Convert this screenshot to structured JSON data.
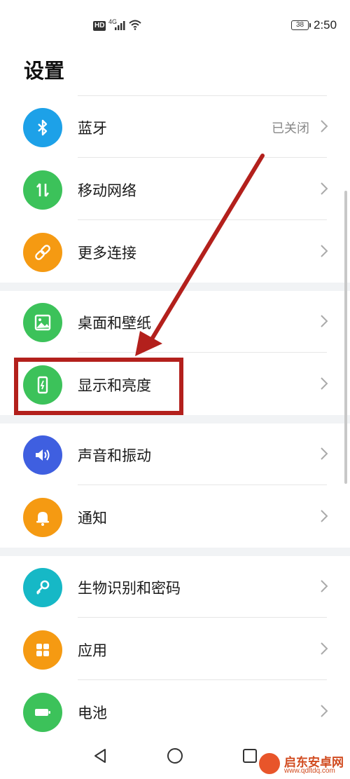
{
  "status_bar": {
    "hd_badge": "HD",
    "network": "4G",
    "battery": "38",
    "time": "2:50"
  },
  "page": {
    "title": "设置"
  },
  "settings": [
    {
      "label": "蓝牙",
      "value": "已关闭",
      "icon": "bluetooth-icon",
      "color": "#1da1e8"
    },
    {
      "label": "移动网络",
      "value": "",
      "icon": "mobile-data-icon",
      "color": "#3cc25a"
    },
    {
      "label": "更多连接",
      "value": "",
      "icon": "link-icon",
      "color": "#f59a12"
    },
    {
      "label": "桌面和壁纸",
      "value": "",
      "icon": "wallpaper-icon",
      "color": "#3cc25a"
    },
    {
      "label": "显示和亮度",
      "value": "",
      "icon": "display-brightness-icon",
      "color": "#3cc25a"
    },
    {
      "label": "声音和振动",
      "value": "",
      "icon": "sound-icon",
      "color": "#3f5fe0"
    },
    {
      "label": "通知",
      "value": "",
      "icon": "bell-icon",
      "color": "#f59a12"
    },
    {
      "label": "生物识别和密码",
      "value": "",
      "icon": "key-icon",
      "color": "#16b8c6"
    },
    {
      "label": "应用",
      "value": "",
      "icon": "apps-grid-icon",
      "color": "#f59a12"
    },
    {
      "label": "电池",
      "value": "",
      "icon": "battery-icon",
      "color": "#3cc25a"
    }
  ],
  "annotation": {
    "highlight_color": "#b3201c"
  },
  "watermark": {
    "text": "启东安卓网",
    "url": "www.qdltdq.com"
  }
}
